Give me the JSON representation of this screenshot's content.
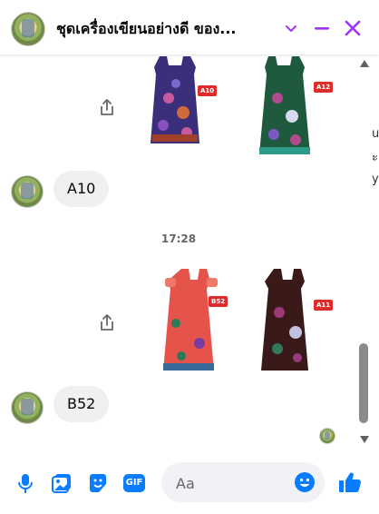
{
  "header": {
    "title": "ชุดเครื่องเขียนอย่างดี ของ...",
    "accent": "#a033ff"
  },
  "messages": [
    {
      "type": "images",
      "tags": [
        "A10",
        "A12"
      ]
    },
    {
      "type": "text",
      "sender": "other",
      "text": "A10"
    },
    {
      "type": "timestamp",
      "text": "17:28"
    },
    {
      "type": "images",
      "tags": [
        "B52",
        "A11"
      ]
    },
    {
      "type": "text",
      "sender": "other",
      "text": "B52"
    }
  ],
  "composer": {
    "placeholder": "Aa",
    "icons": [
      "microphone-icon",
      "photo-icon",
      "sticker-icon",
      "gif-icon",
      "emoji-icon",
      "thumbs-up-icon"
    ],
    "gif_label": "GIF",
    "accent": "#0a7cff"
  },
  "page_behind": {
    "fragments": [
      "u",
      "ะ",
      "y"
    ]
  }
}
